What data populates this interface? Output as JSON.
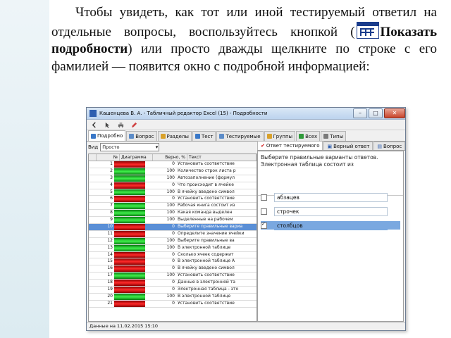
{
  "instruction": {
    "before": "Чтобы увидеть, как тот или иной тестируемый ответил на отдельные вопросы, воспользуйтесь кнопкой (",
    "button_name": "Показать подробности",
    "after": ") или просто дважды щелкните по строке с его фамилией — появится окно с подробной информацией:"
  },
  "window": {
    "title": "Кашенцева В. А. - Табличный редактор Excel (15) - Подробности",
    "tabs": [
      {
        "label": "Подробно",
        "color": "#3a78c8"
      },
      {
        "label": "Вопрос",
        "color": "#5c8cc8"
      },
      {
        "label": "Разделы",
        "color": "#d9a12a"
      },
      {
        "label": "Тест",
        "color": "#3a78c8"
      },
      {
        "label": "Тестируемые",
        "color": "#5c8cc8"
      },
      {
        "label": "Группы",
        "color": "#d9a12a"
      },
      {
        "label": "Всех",
        "color": "#2f9a3a"
      },
      {
        "label": "Типы",
        "color": "#7a7a7a"
      }
    ],
    "filter_label": "Вид",
    "filter_value": "Просто",
    "grid_headers": [
      "№",
      "Диаграмма",
      "Верно, %",
      "Текст"
    ],
    "rows": [
      {
        "n": "1",
        "bar": "r",
        "pct": "0",
        "text": "Установить соответствие",
        "sel": false
      },
      {
        "n": "2",
        "bar": "g",
        "pct": "100",
        "text": "Количество строк листа р",
        "sel": false
      },
      {
        "n": "3",
        "bar": "g",
        "pct": "100",
        "text": "Автозаполнение (формул",
        "sel": false
      },
      {
        "n": "4",
        "bar": "r",
        "pct": "0",
        "text": "Что происходит в ячейке",
        "sel": false
      },
      {
        "n": "5",
        "bar": "g",
        "pct": "100",
        "text": "В ячейку введено символ",
        "sel": false
      },
      {
        "n": "6",
        "bar": "r",
        "pct": "0",
        "text": "Установить соответствие",
        "sel": false
      },
      {
        "n": "7",
        "bar": "g",
        "pct": "100",
        "text": "Рабочая книга состоит из",
        "sel": false
      },
      {
        "n": "8",
        "bar": "g",
        "pct": "100",
        "text": "Какая команда выделен",
        "sel": false
      },
      {
        "n": "9",
        "bar": "g",
        "pct": "100",
        "text": "Выделенные на рабочем",
        "sel": false
      },
      {
        "n": "10",
        "bar": "r",
        "pct": "0",
        "text": "Выберите правильные вариа",
        "sel": true
      },
      {
        "n": "11",
        "bar": "r",
        "pct": "0",
        "text": "Определите значение ячейки",
        "sel": false
      },
      {
        "n": "12",
        "bar": "g",
        "pct": "100",
        "text": "Выберите правильные ва",
        "sel": false
      },
      {
        "n": "13",
        "bar": "g",
        "pct": "100",
        "text": "В электронной таблице",
        "sel": false
      },
      {
        "n": "14",
        "bar": "r",
        "pct": "0",
        "text": "Сколько ячеек содержит",
        "sel": false
      },
      {
        "n": "15",
        "bar": "r",
        "pct": "0",
        "text": "В электронной таблице А",
        "sel": false
      },
      {
        "n": "16",
        "bar": "r",
        "pct": "0",
        "text": "В ячейку введено символ",
        "sel": false
      },
      {
        "n": "17",
        "bar": "g",
        "pct": "100",
        "text": "Установить соответствие",
        "sel": false
      },
      {
        "n": "18",
        "bar": "r",
        "pct": "0",
        "text": "Данные в электронной та",
        "sel": false
      },
      {
        "n": "19",
        "bar": "r",
        "pct": "0",
        "text": "Электронная таблица - это",
        "sel": false
      },
      {
        "n": "20",
        "bar": "g",
        "pct": "100",
        "text": "В электронной таблице",
        "sel": false
      },
      {
        "n": "21",
        "bar": "r",
        "pct": "0",
        "text": "Установить соответствие",
        "sel": false
      }
    ],
    "right_tabs": [
      "Ответ тестируемого",
      "Верный ответ",
      "Вопрос"
    ],
    "question_text": "Выберите правильные варианты ответов. Электронная таблица состоит из",
    "answers": [
      {
        "label": "абзацев",
        "checked": false,
        "sel": false
      },
      {
        "label": "строчек",
        "checked": false,
        "sel": false
      },
      {
        "label": "столбцов",
        "checked": true,
        "sel": true
      }
    ],
    "status": "Данные на 11.02.2015 15:10"
  },
  "colors": {
    "correct": "#2ecc40",
    "wrong": "#e01010",
    "selection": "#5a8fd6"
  }
}
